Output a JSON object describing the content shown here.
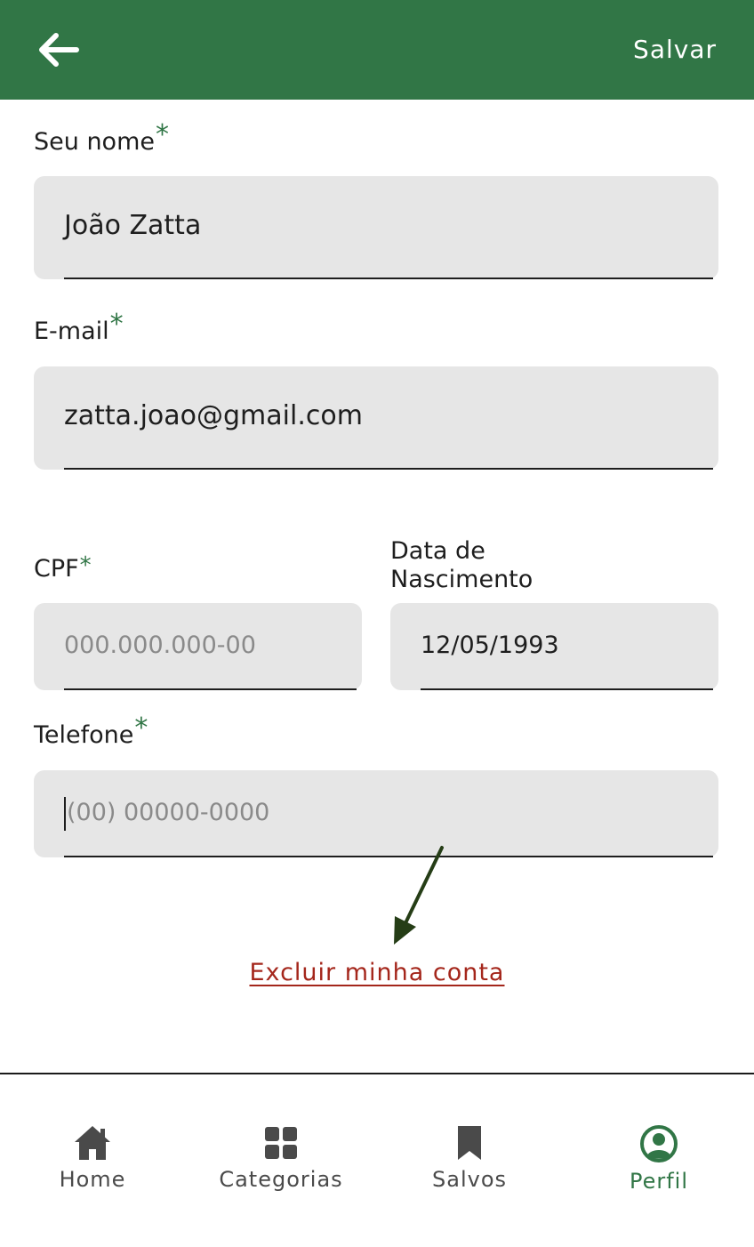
{
  "header": {
    "back_icon": "arrow-left-icon",
    "save_label": "Salvar",
    "color": "#317646"
  },
  "form": {
    "name": {
      "label": "Seu nome",
      "required_mark": "*",
      "value": "João Zatta"
    },
    "email": {
      "label": "E-mail",
      "required_mark": "*",
      "value": "zatta.joao@gmail.com"
    },
    "cpf": {
      "label": "CPF",
      "required_mark": "*",
      "placeholder": "000.000.000-00"
    },
    "birthdate": {
      "label_line1": "Data de",
      "label_line2": "Nascimento",
      "value": "12/05/1993"
    },
    "phone": {
      "label": "Telefone",
      "required_mark": "*",
      "placeholder": "(00) 00000-0000",
      "focused": true
    }
  },
  "delete_account": {
    "label": "Excluir minha conta",
    "color": "#a4261b"
  },
  "bottom_nav": {
    "items": [
      {
        "label": "Home",
        "icon": "home-icon"
      },
      {
        "label": "Categorias",
        "icon": "grid-icon"
      },
      {
        "label": "Salvos",
        "icon": "bookmark-icon"
      },
      {
        "label": "Perfil",
        "icon": "user-circle-icon",
        "active": true
      }
    ]
  }
}
